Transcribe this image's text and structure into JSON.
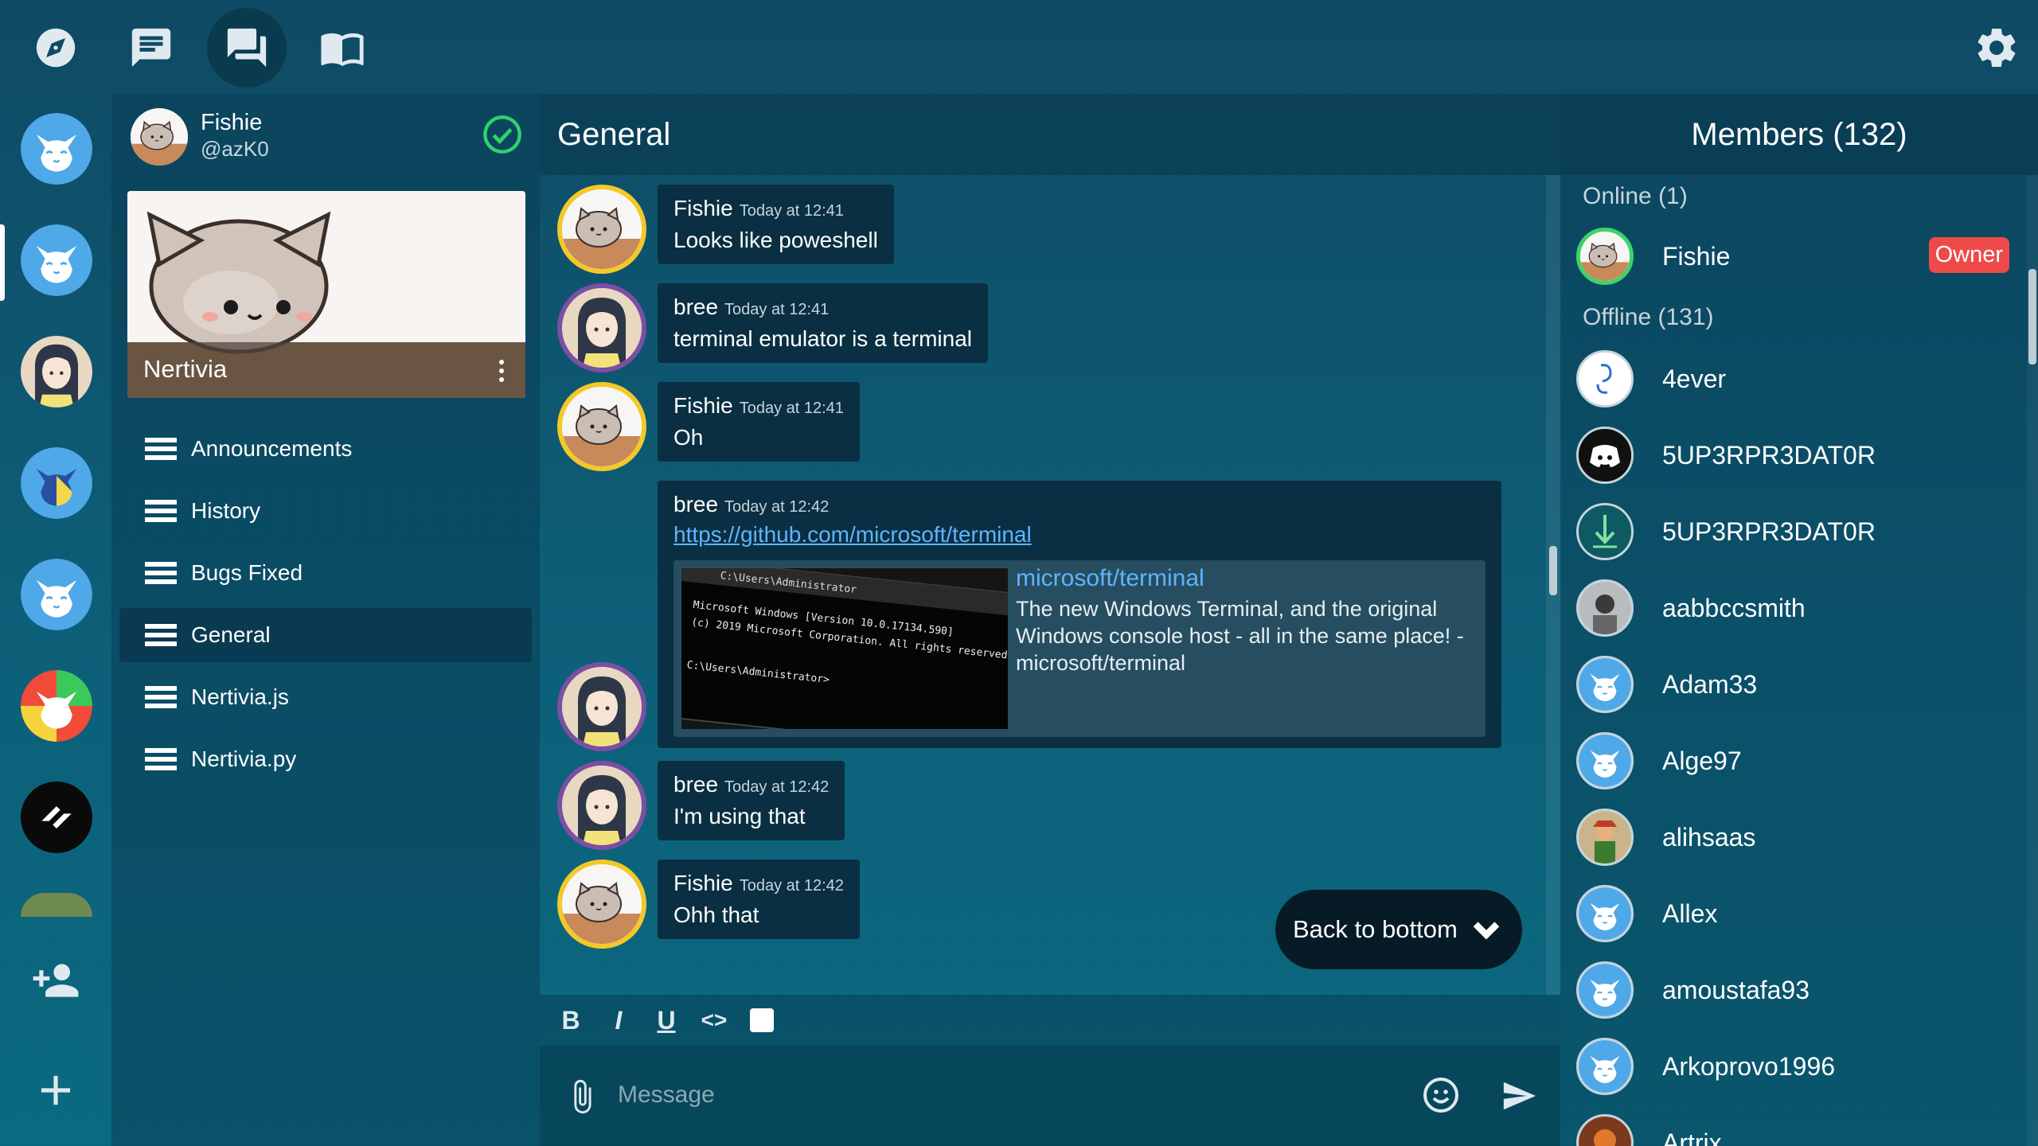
{
  "topbar": {
    "nav_icons": [
      "explore-icon",
      "direct-messages-icon",
      "servers-icon",
      "changelog-icon"
    ],
    "active": "servers-icon",
    "settings_icon": "gear-icon"
  },
  "rail": {
    "servers": [
      "nertivia-server-1",
      "nertivia-server-2",
      "anime-server",
      "nertivia-server-3",
      "nertivia-server-4",
      "colorful-server",
      "black-white-server",
      "partial-server"
    ],
    "add_friend_icon": "add-friend-icon",
    "add_server_icon": "plus-icon"
  },
  "profile": {
    "name": "Fishie",
    "tag": "@azK0",
    "status": "online"
  },
  "server": {
    "name": "Nertivia"
  },
  "channels": [
    {
      "name": "Announcements"
    },
    {
      "name": "History"
    },
    {
      "name": "Bugs Fixed"
    },
    {
      "name": "General",
      "active": true
    },
    {
      "name": "Nertivia.js"
    },
    {
      "name": "Nertivia.py"
    }
  ],
  "chat": {
    "title": "General",
    "messages": [
      {
        "author": "Fishie",
        "time": "Today at 12:41",
        "text": "Looks like poweshell"
      },
      {
        "author": "bree",
        "time": "Today at 12:41",
        "text": "terminal emulator is a terminal"
      },
      {
        "author": "Fishie",
        "time": "Today at 12:41",
        "text": "Oh"
      },
      {
        "author": "bree",
        "time": "Today at 12:42",
        "link": "https://github.com/microsoft/terminal",
        "embed": {
          "title": "microsoft/terminal",
          "description": "The new Windows Terminal, and the original Windows console host - all in the same place! - microsoft/terminal",
          "image_lines": [
            "C:\\Users\\Administrator",
            "Microsoft Windows [Version 10.0.17134.590]",
            "(c) 2019 Microsoft Corporation. All rights reserved.",
            "C:\\Users\\Administrator>"
          ]
        }
      },
      {
        "author": "bree",
        "time": "Today at 12:42",
        "text": "I'm using that"
      },
      {
        "author": "Fishie",
        "time": "Today at 12:42",
        "text": "Ohh that"
      }
    ],
    "back_to_bottom": "Back to bottom",
    "composer": {
      "placeholder": "Message",
      "format_buttons": [
        "B",
        "I",
        "U",
        "<>",
        "color"
      ]
    }
  },
  "members": {
    "title": "Members (132)",
    "online_label": "Online (1)",
    "offline_label": "Offline (131)",
    "online": [
      {
        "name": "Fishie",
        "badge": "Owner"
      }
    ],
    "offline": [
      {
        "name": "4ever"
      },
      {
        "name": "5UP3RPR3DAT0R"
      },
      {
        "name": "5UP3RPR3DAT0R"
      },
      {
        "name": "aabbccsmith"
      },
      {
        "name": "Adam33"
      },
      {
        "name": "Alge97"
      },
      {
        "name": "alihsaas"
      },
      {
        "name": "Allex"
      },
      {
        "name": "amoustafa93"
      },
      {
        "name": "Arkoprovo1996"
      },
      {
        "name": "Artrix"
      }
    ]
  },
  "colors": {
    "accent_link": "#5fb4ff",
    "online": "#3bd46a",
    "owner_badge": "#ee4a4a",
    "nertivia_blue": "#4a9fe0"
  }
}
